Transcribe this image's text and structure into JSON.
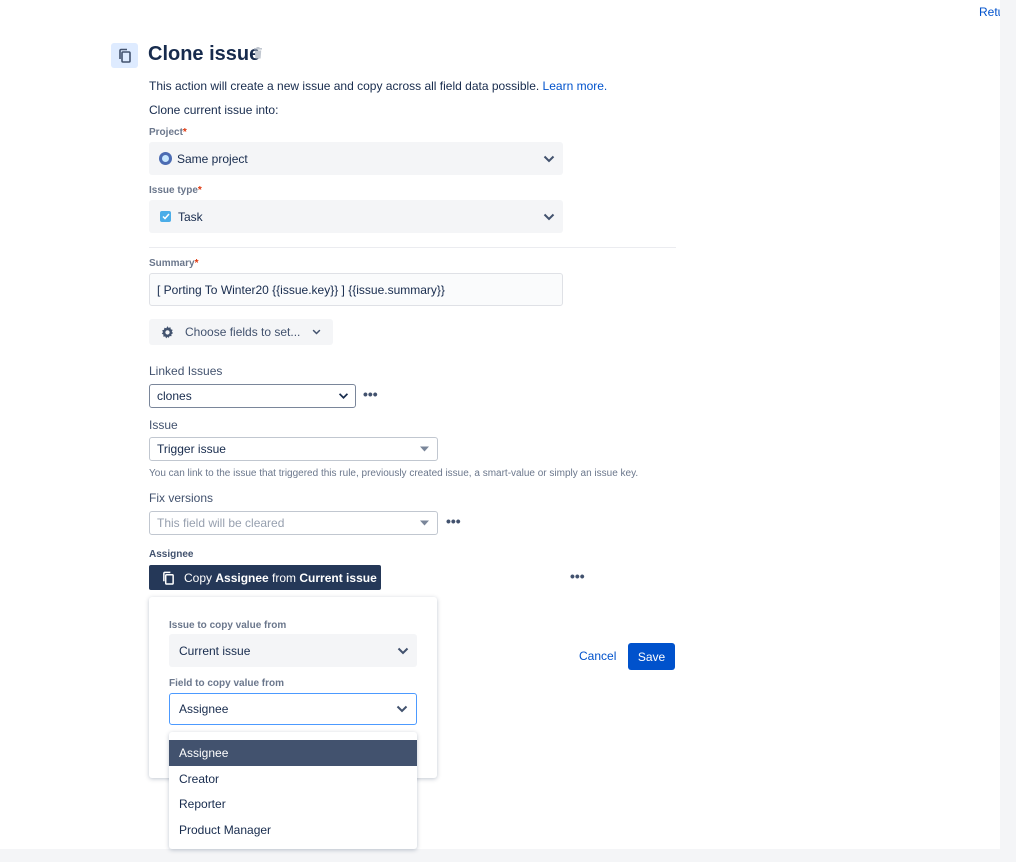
{
  "header": {
    "return_label": "Return",
    "title": "Clone issue",
    "description": "This action will create a new issue and copy across all field data possible.",
    "learn_more": "Learn more.",
    "subtitle": "Clone current issue into:"
  },
  "project": {
    "label": "Project",
    "required": "*",
    "value": "Same project"
  },
  "issue_type": {
    "label": "Issue type",
    "required": "*",
    "value": "Task"
  },
  "summary": {
    "label": "Summary",
    "required": "*",
    "value": "[ Porting To Winter20 {{issue.key}} ] {{issue.summary}}"
  },
  "choose_fields": {
    "label": "Choose fields to set..."
  },
  "linked_issues": {
    "label": "Linked Issues",
    "value": "clones"
  },
  "issue": {
    "label": "Issue",
    "value": "Trigger issue",
    "help": "You can link to the issue that triggered this rule, previously created issue, a smart-value or simply an issue key."
  },
  "fix_versions": {
    "label": "Fix versions",
    "placeholder": "This field will be cleared"
  },
  "assignee": {
    "label": "Assignee",
    "button_prefix": "Copy ",
    "button_field": "Assignee",
    "button_mid": " from ",
    "button_source": "Current issue"
  },
  "copy_panel": {
    "issue_label": "Issue to copy value from",
    "issue_value": "Current issue",
    "field_label": "Field to copy value from",
    "field_value": "Assignee"
  },
  "dropdown_options": [
    "Assignee",
    "Creator",
    "Reporter",
    "Product Manager"
  ],
  "actions": {
    "cancel": "Cancel",
    "save": "Save"
  },
  "more_actions": "•••",
  "colors": {
    "primary": "#0052cc",
    "dark": "#253858",
    "text": "#172b4d"
  }
}
